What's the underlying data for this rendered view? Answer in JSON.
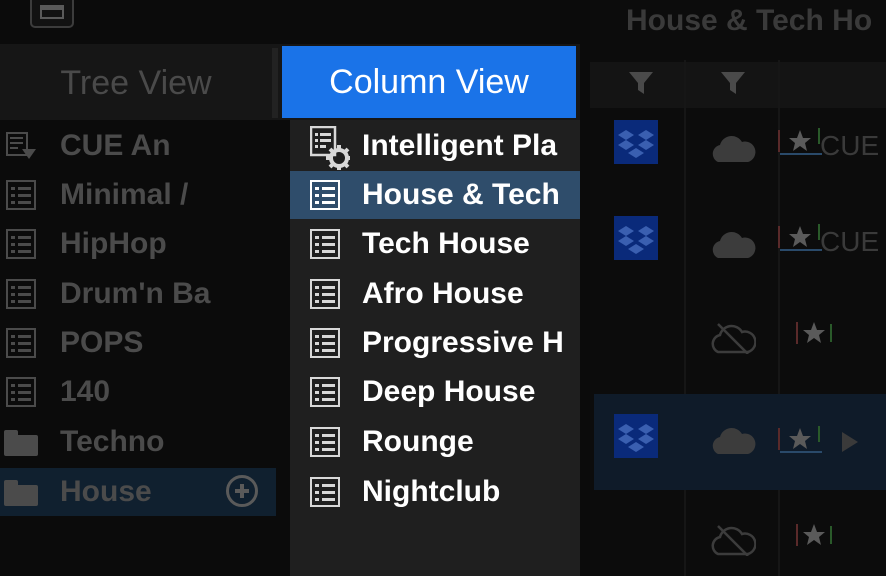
{
  "tabs": {
    "tree_view": "Tree View",
    "column_view": "Column View"
  },
  "tree": {
    "items": [
      {
        "label": "CUE An",
        "icon": "smart-playlist-icon"
      },
      {
        "label": "Minimal /",
        "icon": "playlist-icon"
      },
      {
        "label": "HipHop",
        "icon": "playlist-icon"
      },
      {
        "label": "Drum'n Ba",
        "icon": "playlist-icon"
      },
      {
        "label": "POPS",
        "icon": "playlist-icon"
      },
      {
        "label": "140",
        "icon": "playlist-icon"
      },
      {
        "label": "Techno",
        "icon": "folder-icon"
      },
      {
        "label": "House",
        "icon": "folder-icon",
        "selected": true
      }
    ],
    "add_icon": "plus-circle-icon"
  },
  "column": {
    "items": [
      {
        "label": "Intelligent Pla",
        "icon": "intelligent-playlist-icon"
      },
      {
        "label": "House & Tech",
        "icon": "playlist-icon",
        "selected": true
      },
      {
        "label": "Tech House",
        "icon": "playlist-icon"
      },
      {
        "label": "Afro House",
        "icon": "playlist-icon"
      },
      {
        "label": "Progressive H",
        "icon": "playlist-icon"
      },
      {
        "label": "Deep House",
        "icon": "playlist-icon"
      },
      {
        "label": "Rounge",
        "icon": "playlist-icon"
      },
      {
        "label": "Nightclub",
        "icon": "playlist-icon"
      }
    ]
  },
  "tracks": {
    "title": "House & Tech Ho",
    "filter_icon": "filter-icon",
    "rows": [
      {
        "dropbox": true,
        "cloud": "synced",
        "cue_label": "CUE"
      },
      {
        "dropbox": true,
        "cloud": "synced",
        "cue_label": "CUE"
      },
      {
        "dropbox": false,
        "cloud": "offline",
        "cue_label": ""
      },
      {
        "dropbox": true,
        "cloud": "synced",
        "cue_label": "",
        "highlight": true
      },
      {
        "dropbox": false,
        "cloud": "offline",
        "cue_label": ""
      }
    ]
  },
  "colors": {
    "accent": "#1a73e8",
    "selected_row": "#2f4d6b",
    "dropbox": "#0a2a7a"
  }
}
